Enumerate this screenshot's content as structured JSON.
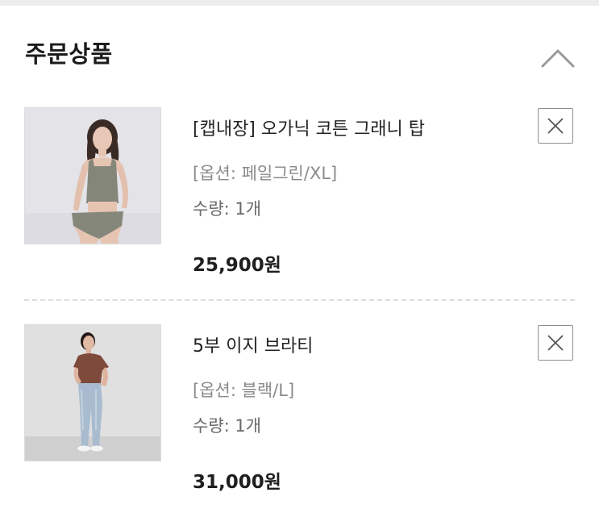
{
  "section": {
    "title": "주문상품"
  },
  "icons": {
    "toggle": "chevron-up-icon",
    "remove": "close-icon"
  },
  "products": [
    {
      "name": "[캡내장] 오가닉 코튼 그래니 탑",
      "option": "[옵션: 페일그린/XL]",
      "quantity": "수량: 1개",
      "price": "25,900원"
    },
    {
      "name": "5부 이지 브라티",
      "option": "[옵션: 블랙/L]",
      "quantity": "수량: 1개",
      "price": "31,000원"
    }
  ],
  "colors": {
    "background": "#ffffff",
    "top_strip": "#ececec",
    "title_text": "#1c1c1c",
    "option_text": "#8a8a8a",
    "divider": "#dedede",
    "button_border": "#8f8f8f"
  }
}
